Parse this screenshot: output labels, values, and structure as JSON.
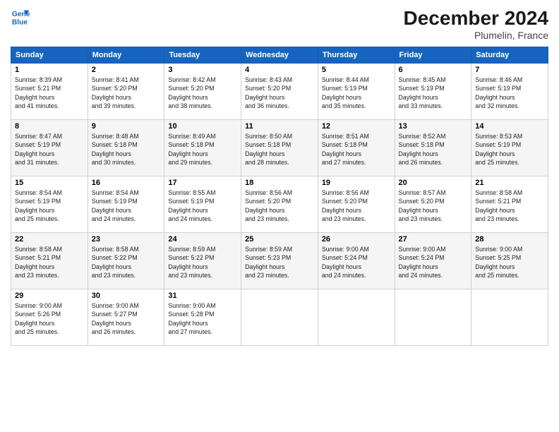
{
  "logo": {
    "line1": "General",
    "line2": "Blue"
  },
  "title": "December 2024",
  "location": "Plumelin, France",
  "days_header": [
    "Sunday",
    "Monday",
    "Tuesday",
    "Wednesday",
    "Thursday",
    "Friday",
    "Saturday"
  ],
  "weeks": [
    [
      {
        "day": "1",
        "sunrise": "8:39 AM",
        "sunset": "5:21 PM",
        "daylight": "8 hours and 41 minutes."
      },
      {
        "day": "2",
        "sunrise": "8:41 AM",
        "sunset": "5:20 PM",
        "daylight": "8 hours and 39 minutes."
      },
      {
        "day": "3",
        "sunrise": "8:42 AM",
        "sunset": "5:20 PM",
        "daylight": "8 hours and 38 minutes."
      },
      {
        "day": "4",
        "sunrise": "8:43 AM",
        "sunset": "5:20 PM",
        "daylight": "8 hours and 36 minutes."
      },
      {
        "day": "5",
        "sunrise": "8:44 AM",
        "sunset": "5:19 PM",
        "daylight": "8 hours and 35 minutes."
      },
      {
        "day": "6",
        "sunrise": "8:45 AM",
        "sunset": "5:19 PM",
        "daylight": "8 hours and 33 minutes."
      },
      {
        "day": "7",
        "sunrise": "8:46 AM",
        "sunset": "5:19 PM",
        "daylight": "8 hours and 32 minutes."
      }
    ],
    [
      {
        "day": "8",
        "sunrise": "8:47 AM",
        "sunset": "5:19 PM",
        "daylight": "8 hours and 31 minutes."
      },
      {
        "day": "9",
        "sunrise": "8:48 AM",
        "sunset": "5:18 PM",
        "daylight": "8 hours and 30 minutes."
      },
      {
        "day": "10",
        "sunrise": "8:49 AM",
        "sunset": "5:18 PM",
        "daylight": "8 hours and 29 minutes."
      },
      {
        "day": "11",
        "sunrise": "8:50 AM",
        "sunset": "5:18 PM",
        "daylight": "8 hours and 28 minutes."
      },
      {
        "day": "12",
        "sunrise": "8:51 AM",
        "sunset": "5:18 PM",
        "daylight": "8 hours and 27 minutes."
      },
      {
        "day": "13",
        "sunrise": "8:52 AM",
        "sunset": "5:18 PM",
        "daylight": "8 hours and 26 minutes."
      },
      {
        "day": "14",
        "sunrise": "8:53 AM",
        "sunset": "5:19 PM",
        "daylight": "8 hours and 25 minutes."
      }
    ],
    [
      {
        "day": "15",
        "sunrise": "8:54 AM",
        "sunset": "5:19 PM",
        "daylight": "8 hours and 25 minutes."
      },
      {
        "day": "16",
        "sunrise": "8:54 AM",
        "sunset": "5:19 PM",
        "daylight": "8 hours and 24 minutes."
      },
      {
        "day": "17",
        "sunrise": "8:55 AM",
        "sunset": "5:19 PM",
        "daylight": "8 hours and 24 minutes."
      },
      {
        "day": "18",
        "sunrise": "8:56 AM",
        "sunset": "5:20 PM",
        "daylight": "8 hours and 23 minutes."
      },
      {
        "day": "19",
        "sunrise": "8:56 AM",
        "sunset": "5:20 PM",
        "daylight": "8 hours and 23 minutes."
      },
      {
        "day": "20",
        "sunrise": "8:57 AM",
        "sunset": "5:20 PM",
        "daylight": "8 hours and 23 minutes."
      },
      {
        "day": "21",
        "sunrise": "8:58 AM",
        "sunset": "5:21 PM",
        "daylight": "8 hours and 23 minutes."
      }
    ],
    [
      {
        "day": "22",
        "sunrise": "8:58 AM",
        "sunset": "5:21 PM",
        "daylight": "8 hours and 23 minutes."
      },
      {
        "day": "23",
        "sunrise": "8:58 AM",
        "sunset": "5:22 PM",
        "daylight": "8 hours and 23 minutes."
      },
      {
        "day": "24",
        "sunrise": "8:59 AM",
        "sunset": "5:22 PM",
        "daylight": "8 hours and 23 minutes."
      },
      {
        "day": "25",
        "sunrise": "8:59 AM",
        "sunset": "5:23 PM",
        "daylight": "8 hours and 23 minutes."
      },
      {
        "day": "26",
        "sunrise": "9:00 AM",
        "sunset": "5:24 PM",
        "daylight": "8 hours and 24 minutes."
      },
      {
        "day": "27",
        "sunrise": "9:00 AM",
        "sunset": "5:24 PM",
        "daylight": "8 hours and 24 minutes."
      },
      {
        "day": "28",
        "sunrise": "9:00 AM",
        "sunset": "5:25 PM",
        "daylight": "8 hours and 25 minutes."
      }
    ],
    [
      {
        "day": "29",
        "sunrise": "9:00 AM",
        "sunset": "5:26 PM",
        "daylight": "8 hours and 25 minutes."
      },
      {
        "day": "30",
        "sunrise": "9:00 AM",
        "sunset": "5:27 PM",
        "daylight": "8 hours and 26 minutes."
      },
      {
        "day": "31",
        "sunrise": "9:00 AM",
        "sunset": "5:28 PM",
        "daylight": "8 hours and 27 minutes."
      },
      null,
      null,
      null,
      null
    ]
  ]
}
